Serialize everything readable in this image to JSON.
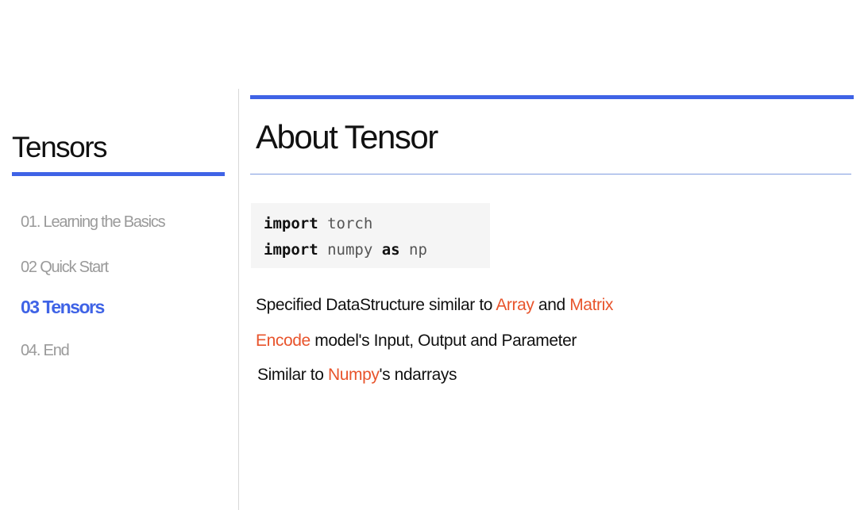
{
  "sidebar": {
    "title": "Tensors",
    "items": [
      {
        "label": "01. Learning the Basics",
        "active": false
      },
      {
        "label": "02 Quick Start",
        "active": false
      },
      {
        "label": "03 Tensors",
        "active": true
      },
      {
        "label": "04. End",
        "active": false
      }
    ]
  },
  "main": {
    "title": "About Tensor",
    "code": {
      "line1": {
        "kw": "import",
        "rest": " torch"
      },
      "line2": {
        "kw1": "import",
        "mid": " numpy ",
        "kw2": "as",
        "rest": " np"
      }
    },
    "bullets": [
      {
        "pre": "Specified DataStructure similar to ",
        "hl1": "Array",
        "mid": " and ",
        "hl2": "Matrix",
        "post": ""
      },
      {
        "pre": "",
        "hl1": "Encode",
        "mid": " model's Input, Output and Parameter",
        "hl2": "",
        "post": ""
      },
      {
        "pre": "Similar to ",
        "hl1": "Numpy",
        "mid": "'s ndarrays",
        "hl2": "",
        "post": ""
      }
    ]
  },
  "colors": {
    "accent": "#3f63e6",
    "highlight": "#e8542c",
    "muted": "#9a9a9a"
  }
}
